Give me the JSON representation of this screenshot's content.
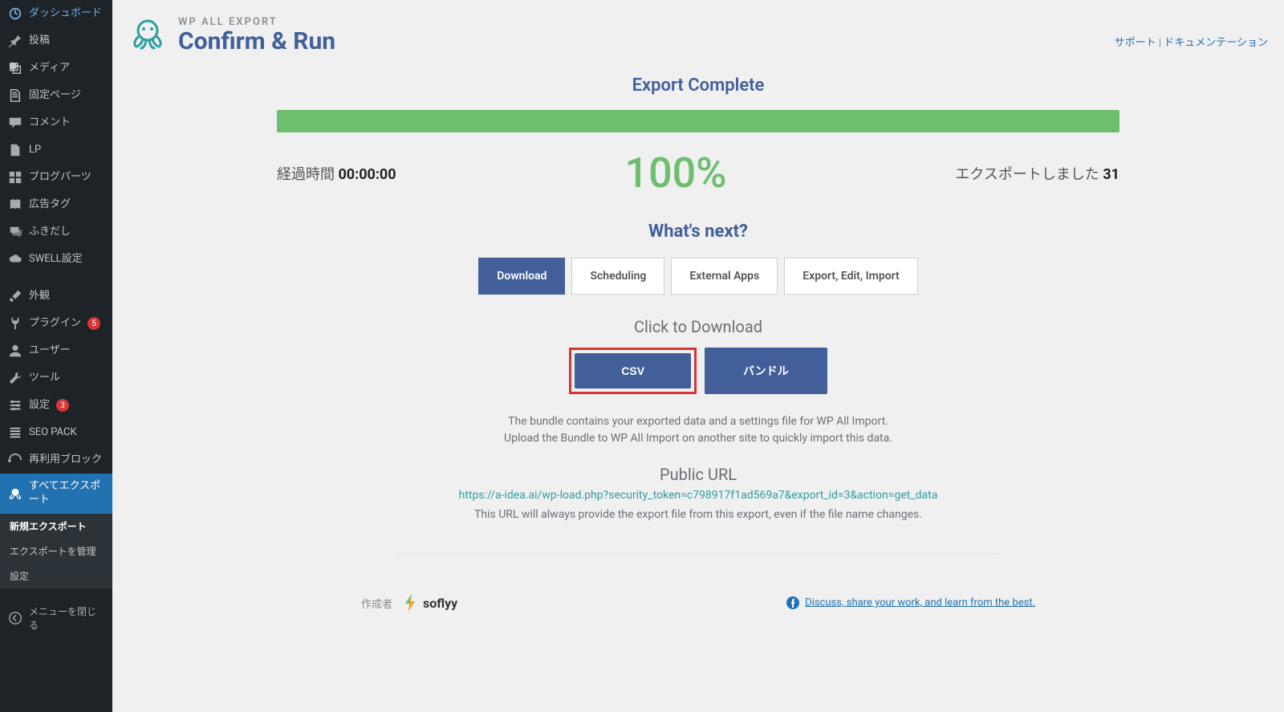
{
  "sidebar": {
    "items": [
      {
        "label": "ダッシュボード"
      },
      {
        "label": "投稿"
      },
      {
        "label": "メディア"
      },
      {
        "label": "固定ページ"
      },
      {
        "label": "コメント"
      },
      {
        "label": "LP"
      },
      {
        "label": "ブログパーツ"
      },
      {
        "label": "広告タグ"
      },
      {
        "label": "ふきだし"
      },
      {
        "label": "SWELL設定"
      },
      {
        "label": "外観"
      },
      {
        "label": "プラグイン",
        "badge": "5"
      },
      {
        "label": "ユーザー"
      },
      {
        "label": "ツール"
      },
      {
        "label": "設定",
        "badge": "3"
      },
      {
        "label": "SEO PACK"
      },
      {
        "label": "再利用ブロック"
      },
      {
        "label": "すべてエクスポート"
      }
    ],
    "sub_items": [
      {
        "label": "新規エクスポート"
      },
      {
        "label": "エクスポートを管理"
      },
      {
        "label": "設定"
      }
    ],
    "collapse_label": "メニューを閉じる"
  },
  "header": {
    "subtitle": "WP ALL EXPORT",
    "title": "Confirm & Run",
    "support_label": "サポート",
    "sep": " | ",
    "docs_label": "ドキュメンテーション"
  },
  "export": {
    "complete_title": "Export Complete",
    "elapsed_label": "経過時間",
    "elapsed_value": "00:00:00",
    "percent": "100%",
    "exported_label": "エクスポートしました",
    "exported_count": "31",
    "whats_next": "What's next?",
    "tabs": [
      {
        "label": "Download"
      },
      {
        "label": "Scheduling"
      },
      {
        "label": "External Apps"
      },
      {
        "label": "Export, Edit, Import"
      }
    ],
    "click_to_download": "Click to Download",
    "csv_btn": "CSV",
    "bundle_btn": "バンドル",
    "bundle_text_1": "The bundle contains your exported data and a settings file for WP All Import.",
    "bundle_text_2": "Upload the Bundle to WP All Import on another site to quickly import this data.",
    "public_url_heading": "Public URL",
    "public_url": "https://a-idea.ai/wp-load.php?security_token=c798917f1ad569a7&export_id=3&action=get_data",
    "public_url_note": "This URL will always provide the export file from this export, even if the file name changes."
  },
  "footer": {
    "created_by": "作成者",
    "brand": "soflyy",
    "discuss": "Discuss, share your work, and learn from the best."
  }
}
